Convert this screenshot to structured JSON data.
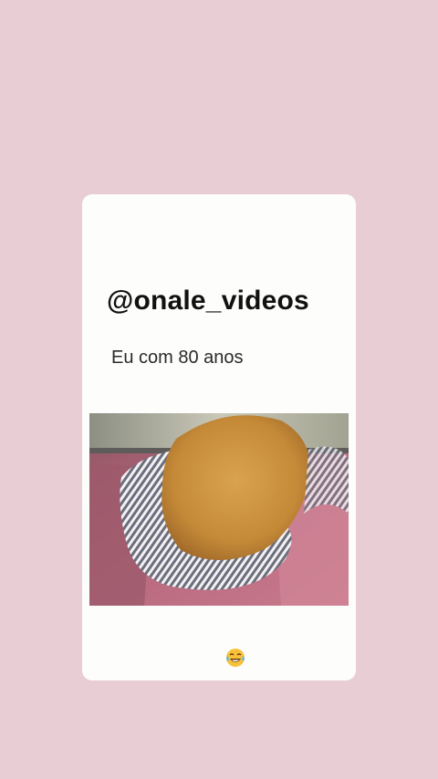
{
  "post": {
    "username": "@onale_videos",
    "caption": "Eu com 80 anos",
    "reaction_emoji": "laughing-tears-emoji"
  },
  "colors": {
    "background": "#e8cdd4",
    "card": "#fdfdfb"
  }
}
